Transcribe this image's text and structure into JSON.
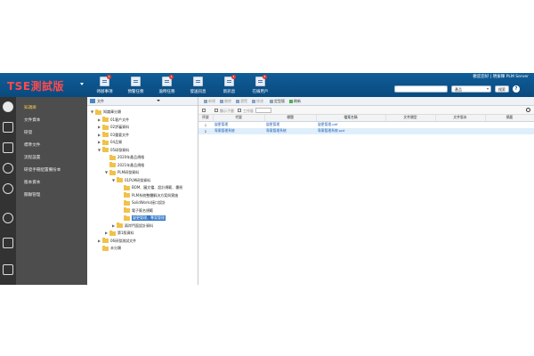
{
  "app": {
    "brand": "TSE測試版",
    "user_info": "歡迎您好 | 明振輝 PLM Server"
  },
  "nav": [
    {
      "label": "待辦事項",
      "badge": "1"
    },
    {
      "label": "預警任務",
      "badge": ""
    },
    {
      "label": "逾時任務",
      "badge": "1"
    },
    {
      "label": "發送訊息",
      "badge": ""
    },
    {
      "label": "新訊息",
      "badge": "1"
    },
    {
      "label": "在線用戶",
      "badge": "5"
    }
  ],
  "search": {
    "select_value": "產品",
    "button_label": "搜索",
    "help_label": "?"
  },
  "icon_strip": [
    "search-icon",
    "home-icon",
    "edit-icon",
    "database-icon",
    "settings-icon",
    "globe-icon",
    "book-icon",
    "id-card-icon"
  ],
  "menu": [
    {
      "label": "知識庫",
      "active": true
    },
    {
      "label": "文件資本",
      "active": false
    },
    {
      "label": "研發",
      "active": false
    },
    {
      "label": "標準文件",
      "active": false
    },
    {
      "label": "流程設置",
      "active": false
    },
    {
      "label": "研發手冊配置備份本",
      "active": false
    },
    {
      "label": "版本資本",
      "active": false
    },
    {
      "label": "關聯管理",
      "active": false
    }
  ],
  "tree_toolbar": {
    "label": "文件"
  },
  "tree": [
    {
      "label": "知識庫分類",
      "depth": 0,
      "arrow": "▼",
      "selected": false
    },
    {
      "label": "01客戶文件",
      "depth": 1,
      "arrow": "▶",
      "selected": false
    },
    {
      "label": "02評審資料",
      "depth": 1,
      "arrow": "▶",
      "selected": false
    },
    {
      "label": "03重要文件",
      "depth": 1,
      "arrow": "▶",
      "selected": false
    },
    {
      "label": "04品質",
      "depth": 1,
      "arrow": "▶",
      "selected": false
    },
    {
      "label": "05研發資料",
      "depth": 1,
      "arrow": "▼",
      "selected": false
    },
    {
      "label": "2020年產品規格",
      "depth": 2,
      "arrow": "",
      "selected": false
    },
    {
      "label": "2021年產品規格",
      "depth": 2,
      "arrow": "",
      "selected": false
    },
    {
      "label": "PLM研發資料",
      "depth": 2,
      "arrow": "▼",
      "selected": false
    },
    {
      "label": "01PLM研發資料",
      "depth": 3,
      "arrow": "▼",
      "selected": false
    },
    {
      "label": "BOM、圖文檔、設計規範、畫冊",
      "depth": 4,
      "arrow": "",
      "selected": false
    },
    {
      "label": "PLM系統整體解決方案與實施",
      "depth": 4,
      "arrow": "",
      "selected": false
    },
    {
      "label": "SolidWorks接口設計",
      "depth": 4,
      "arrow": "",
      "selected": false
    },
    {
      "label": "電子簽名規範",
      "depth": 4,
      "arrow": "",
      "selected": false
    },
    {
      "label": "變更管理、專案管理",
      "depth": 4,
      "arrow": "",
      "selected": true
    },
    {
      "label": "兩岸門面設計資料",
      "depth": 3,
      "arrow": "▶",
      "selected": false
    },
    {
      "label": "第1版資料",
      "depth": 2,
      "arrow": "▶",
      "selected": false
    },
    {
      "label": "06研發測試文件",
      "depth": 1,
      "arrow": "▶",
      "selected": false
    },
    {
      "label": "未分類",
      "depth": 1,
      "arrow": "",
      "selected": false
    }
  ],
  "main_toolbar": {
    "items": [
      {
        "label": "新增",
        "dim": true
      },
      {
        "label": "刪除",
        "dim": true
      },
      {
        "label": "瀏覽",
        "dim": true
      },
      {
        "label": "修改",
        "dim": true
      },
      {
        "label": "定型版",
        "dim": false
      },
      {
        "label": "刷新",
        "dim": false
      }
    ]
  },
  "sub_toolbar": {
    "label_1": "顯示子層",
    "label_2": "工作區"
  },
  "table": {
    "columns": [
      "序號",
      "代號",
      "標題",
      "檔案名稱",
      "文件類型",
      "文件版本",
      "摘要"
    ],
    "rows": [
      [
        "1",
        "變更管理",
        "變更管理",
        "變更管理.pdf",
        "",
        "",
        ""
      ],
      [
        "2",
        "專案管理系統",
        "專案管理系統",
        "專案管理系統.ppt",
        "",
        "",
        ""
      ]
    ]
  },
  "colors": {
    "header_bg": "#0f5d99",
    "brand_red": "#ff4a4a",
    "menu_bg": "#4d4d4d",
    "icon_strip_bg": "#333333",
    "selection_blue": "#3478c6"
  }
}
